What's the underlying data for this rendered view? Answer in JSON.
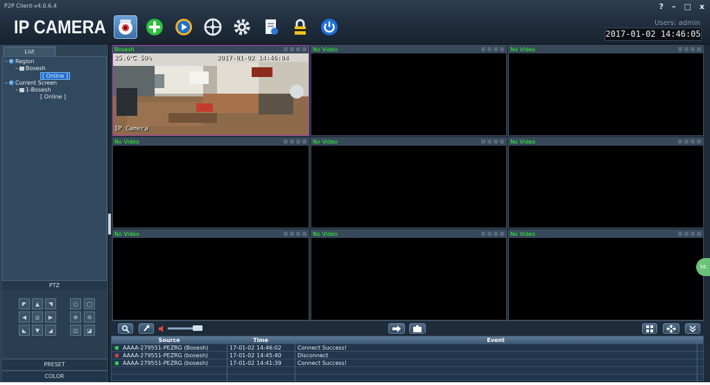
{
  "app": {
    "title": "P2P Client-v4.0.6.4",
    "logo": "IP CAMERA"
  },
  "window_controls": {
    "help": "?",
    "minimize": "–",
    "maximize": "□",
    "close": "x"
  },
  "header": {
    "user_label": "Users: admin",
    "datetime": "2017-01-02 14:46:05"
  },
  "toolbar": {
    "tools": [
      {
        "name": "camera-view-icon",
        "active": true
      },
      {
        "name": "add-device-icon",
        "active": false
      },
      {
        "name": "playback-icon",
        "active": false
      },
      {
        "name": "ptz-control-icon",
        "active": false
      },
      {
        "name": "settings-gear-icon",
        "active": false
      },
      {
        "name": "log-document-icon",
        "active": false
      },
      {
        "name": "lock-icon",
        "active": false
      },
      {
        "name": "power-icon",
        "active": false
      }
    ]
  },
  "sidebar": {
    "tab_label": "List",
    "tree": {
      "region": "Region",
      "device": "Bosesh",
      "device_status": "[ Online ]",
      "current_screen": "Current Screen",
      "screen_device": "1-Bosesh",
      "screen_device_status": "[ Online ]"
    },
    "ptz_label": "PTZ",
    "preset_label": "PRESET",
    "color_label": "COLOR"
  },
  "video_grid": {
    "cells": [
      {
        "label": "Bosesh",
        "has_video": true
      },
      {
        "label": "No Video",
        "has_video": false
      },
      {
        "label": "No Video",
        "has_video": false
      },
      {
        "label": "No Video",
        "has_video": false
      },
      {
        "label": "No Video",
        "has_video": false
      },
      {
        "label": "No Video",
        "has_video": false
      },
      {
        "label": "No Video",
        "has_video": false
      },
      {
        "label": "No Video",
        "has_video": false
      },
      {
        "label": "No Video",
        "has_video": false
      }
    ],
    "osd": {
      "temp_humidity": "25.6℃ 59%",
      "timestamp": "2017-01-02 14:46:04",
      "camera_name": "IP Camera"
    }
  },
  "side_badge": "56",
  "event_log": {
    "headers": {
      "source": "Source",
      "time": "Time",
      "event": "Event"
    },
    "rows": [
      {
        "source": "AAAA-279551-PEZRG (Bosesh)",
        "time": "17-01-02 14:46:02",
        "event": "Connect Success!",
        "status_color": "#2fd24a"
      },
      {
        "source": "AAAA-279551-PEZRG (bosesh)",
        "time": "17-01-02 14:45:40",
        "event": "Disconnect",
        "status_color": "#d83a3a"
      },
      {
        "source": "AAAA-279551-PEZRG (bosesh)",
        "time": "17-01-02 14:41:39",
        "event": "Connect Success!",
        "status_color": "#2fd24a"
      }
    ]
  },
  "colors": {
    "label_green": "#31ff31",
    "active_border": "#b03ab8",
    "accent_blue": "#1e6fd0"
  }
}
